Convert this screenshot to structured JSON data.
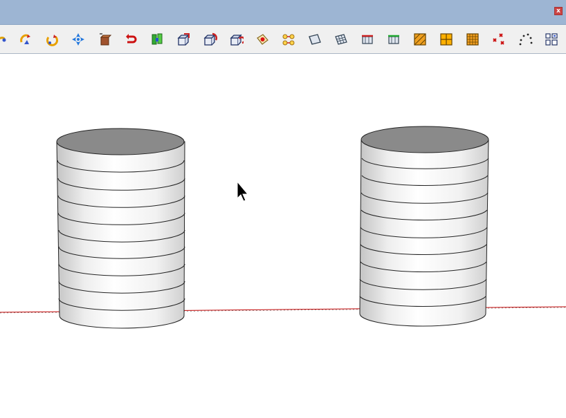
{
  "window": {
    "close_label": "x"
  },
  "toolbar": {
    "tools": [
      {
        "id": "follow-me-partial",
        "icon": "follow-me-icon"
      },
      {
        "id": "rotate",
        "icon": "rotate-icon"
      },
      {
        "id": "orbit",
        "icon": "orbit-icon"
      },
      {
        "id": "move-axis",
        "icon": "move-axis-icon"
      },
      {
        "id": "push-pull",
        "icon": "push-pull-icon"
      },
      {
        "id": "undo-curve",
        "icon": "undo-curve-icon"
      },
      {
        "id": "components",
        "icon": "components-icon"
      },
      {
        "id": "scale-box",
        "icon": "scale-box-icon"
      },
      {
        "id": "rotate-box",
        "icon": "rotate-box-icon"
      },
      {
        "id": "flip-box",
        "icon": "flip-box-icon"
      },
      {
        "id": "paint-bucket",
        "icon": "paint-bucket-icon"
      },
      {
        "id": "group-select",
        "icon": "group-select-icon"
      },
      {
        "id": "grid-plane",
        "icon": "grid-plane-icon"
      },
      {
        "id": "mesh-grid",
        "icon": "mesh-grid-icon"
      },
      {
        "id": "red-plane",
        "icon": "red-plane-icon"
      },
      {
        "id": "green-plane",
        "icon": "green-plane-icon"
      },
      {
        "id": "hatch-fill",
        "icon": "hatch-fill-icon"
      },
      {
        "id": "quad-split",
        "icon": "quad-split-icon"
      },
      {
        "id": "grid-fill",
        "icon": "grid-fill-icon"
      },
      {
        "id": "scatter-points",
        "icon": "scatter-points-icon"
      },
      {
        "id": "arc-dots",
        "icon": "arc-dots-icon"
      },
      {
        "id": "layout-grid",
        "icon": "layout-grid-icon"
      }
    ]
  },
  "colors": {
    "title_bar": "#9db5d3",
    "toolbar_bg": "#f0f0f0",
    "cylinder_top": "#8a8a8a",
    "ground_line_red": "#c00000",
    "ground_line_dark": "#333333"
  },
  "scene": {
    "objects": [
      {
        "id": "cylinder-left",
        "type": "stacked-cylinder",
        "slices": 10
      },
      {
        "id": "cylinder-right",
        "type": "stacked-cylinder",
        "slices": 10
      }
    ],
    "cursor": "arrow-cursor-icon"
  }
}
